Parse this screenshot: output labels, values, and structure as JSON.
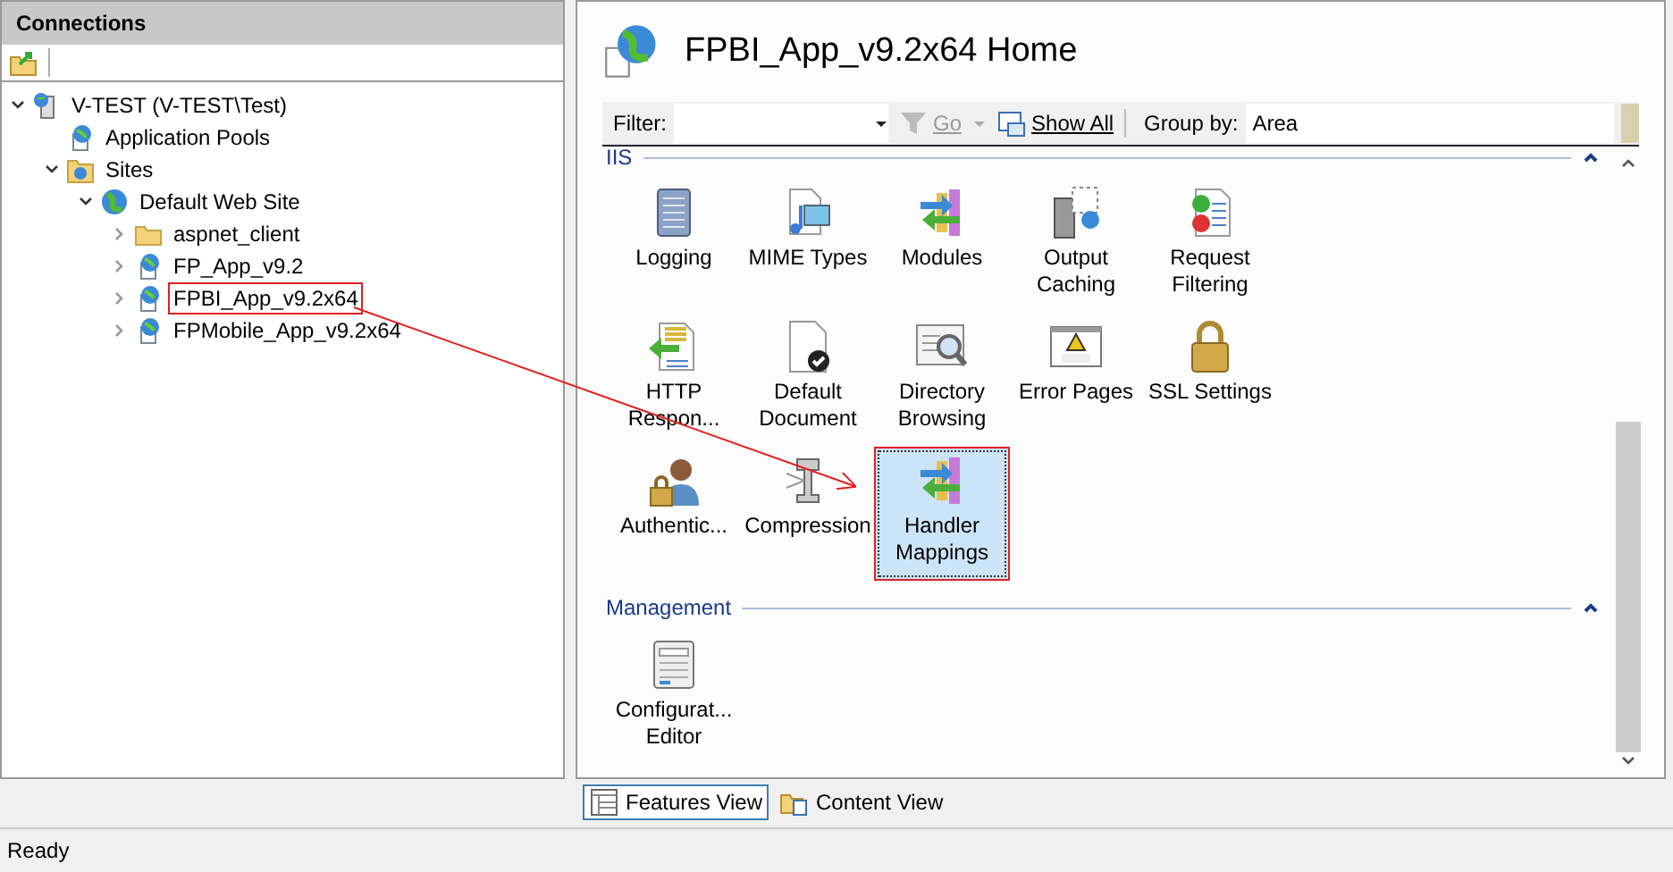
{
  "connections": {
    "title": "Connections",
    "tree": [
      {
        "label": "V-TEST (V-TEST\\Test)",
        "kind": "server",
        "expanded": true,
        "annotated": false,
        "children": [
          {
            "label": "Application Pools",
            "kind": "pool",
            "annotated": false
          },
          {
            "label": "Sites",
            "kind": "sites",
            "expanded": true,
            "annotated": false,
            "children": [
              {
                "label": "Default Web Site",
                "kind": "globe",
                "expanded": true,
                "annotated": false,
                "children": [
                  {
                    "label": "aspnet_client",
                    "kind": "folder",
                    "expanded": false,
                    "annotated": false
                  },
                  {
                    "label": "FP_App_v9.2",
                    "kind": "app",
                    "expanded": false,
                    "annotated": false
                  },
                  {
                    "label": "FPBI_App_v9.2x64",
                    "kind": "app",
                    "expanded": false,
                    "annotated": true
                  },
                  {
                    "label": "FPMobile_App_v9.2x64",
                    "kind": "app",
                    "expanded": false,
                    "annotated": false
                  }
                ]
              }
            ]
          }
        ]
      }
    ]
  },
  "home": {
    "title": "FPBI_App_v9.2x64 Home",
    "filter": {
      "label": "Filter:",
      "go": "Go",
      "show_all": "Show All",
      "group_by_label": "Group by:",
      "group_by": "Area"
    },
    "groups": [
      {
        "title": "IIS",
        "expanded": true,
        "features": [
          {
            "label": "Logging",
            "kind": "log",
            "selected": false,
            "annotated": false
          },
          {
            "label": "MIME Types",
            "kind": "mime",
            "selected": false,
            "annotated": false
          },
          {
            "label": "Modules",
            "kind": "modules",
            "selected": false,
            "annotated": false
          },
          {
            "label": "Output Caching",
            "kind": "cache",
            "selected": false,
            "annotated": false
          },
          {
            "label": "Request Filtering",
            "kind": "filter",
            "selected": false,
            "annotated": false
          },
          {
            "label": "HTTP Respon...",
            "kind": "http",
            "selected": false,
            "annotated": false
          },
          {
            "label": "Default Document",
            "kind": "doc",
            "selected": false,
            "annotated": false
          },
          {
            "label": "Directory Browsing",
            "kind": "browse",
            "selected": false,
            "annotated": false
          },
          {
            "label": "Error Pages",
            "kind": "error",
            "selected": false,
            "annotated": false
          },
          {
            "label": "SSL Settings",
            "kind": "lock",
            "selected": false,
            "annotated": false
          },
          {
            "label": "Authentic...",
            "kind": "auth",
            "selected": false,
            "annotated": false
          },
          {
            "label": "Compression",
            "kind": "clamp",
            "selected": false,
            "annotated": false
          },
          {
            "label": "Handler Mappings",
            "kind": "modules",
            "selected": true,
            "annotated": true
          }
        ]
      },
      {
        "title": "Management",
        "expanded": true,
        "features": [
          {
            "label": "Configurat... Editor",
            "kind": "config",
            "selected": false,
            "annotated": false
          }
        ]
      }
    ]
  },
  "views": [
    {
      "label": "Features View",
      "selected": true
    },
    {
      "label": "Content View",
      "selected": false
    }
  ],
  "status_bar": "Ready"
}
